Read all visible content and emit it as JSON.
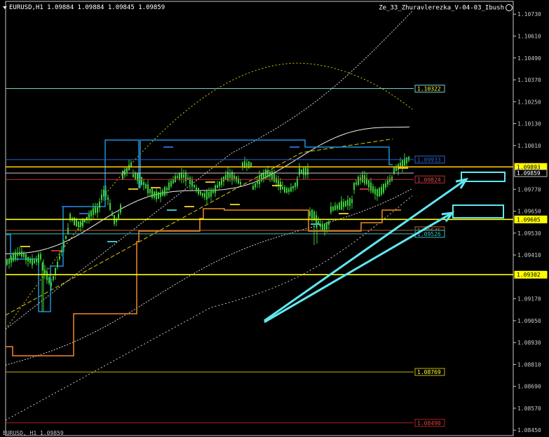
{
  "header": {
    "symbol_info": "EURUSD,H1  1.09884 1.09884 1.09845 1.09859",
    "indicator_name": "Ze_33_Zhuravlerezka_V-04-03_Ibush"
  },
  "footer": {
    "text": "EURUSD, H1 1.09859"
  },
  "icons": {
    "dropdown": "triangle-down-icon",
    "smiley": "smiley-face-icon"
  },
  "chart_data": {
    "type": "candlestick",
    "y_range": [
      1.0842,
      1.108
    ],
    "y_ticks": [
      "1.10730",
      "1.10610",
      "1.10490",
      "1.10370",
      "1.10250",
      "1.10130",
      "1.10010",
      "1.09770",
      "1.09650",
      "1.09530",
      "1.09410",
      "1.09170",
      "1.09050",
      "1.08930",
      "1.08810",
      "1.08690",
      "1.08570",
      "1.08450"
    ],
    "horizontal_levels": [
      {
        "label": "1.10322",
        "value": 1.10322,
        "color": "#6fd0c8",
        "box_fill": "#000000",
        "text_color": "#ffff33"
      },
      {
        "label": "1.09933",
        "value": 1.09933,
        "color": "#2b63c9",
        "box_fill": "#000000",
        "text_color": "#2b63c9"
      },
      {
        "label": "1.09893",
        "value": 1.09893,
        "color": "#ffc400",
        "box_fill": "#ffff00",
        "text_color": "#000000"
      },
      {
        "label": "1.09859",
        "value": 1.09859,
        "color": "#c8c8c8",
        "box_fill": "#000000",
        "text_color": "#ffffff"
      },
      {
        "label": "1.09824",
        "value": 1.09824,
        "color": "#c23030",
        "box_fill": "#000000",
        "text_color": "#e05050"
      },
      {
        "label": "1.09605",
        "value": 1.09605,
        "color": "#ffff00",
        "box_fill": "#ffff00",
        "text_color": "#000000"
      },
      {
        "label": "1.09545",
        "value": 1.09545,
        "color": "#c86a2a",
        "box_fill": "#000000",
        "text_color": "#e07030"
      },
      {
        "label": "1.09526",
        "value": 1.09526,
        "color": "#40c0c0",
        "box_fill": "#000000",
        "text_color": "#40c0c0"
      },
      {
        "label": "1.09302",
        "value": 1.09302,
        "color": "#ffff00",
        "box_fill": "#ffff00",
        "text_color": "#000000"
      },
      {
        "label": "1.08769",
        "value": 1.08769,
        "color": "#c8b400",
        "box_fill": "#000000",
        "text_color": "#ffff33"
      },
      {
        "label": "1.08490",
        "value": 1.0849,
        "color": "#b02020",
        "box_fill": "#000000",
        "text_color": "#e04040"
      }
    ],
    "colors": {
      "background": "#000000",
      "candles": "#3ad13a",
      "axis": "#c8c8c8",
      "arrows": "#60e8f0",
      "highlight_box": "#60e8f0",
      "orange_step": "#f08a24",
      "blue_step": "#1f8fdc",
      "yellow_dash": "#d8c800"
    }
  }
}
